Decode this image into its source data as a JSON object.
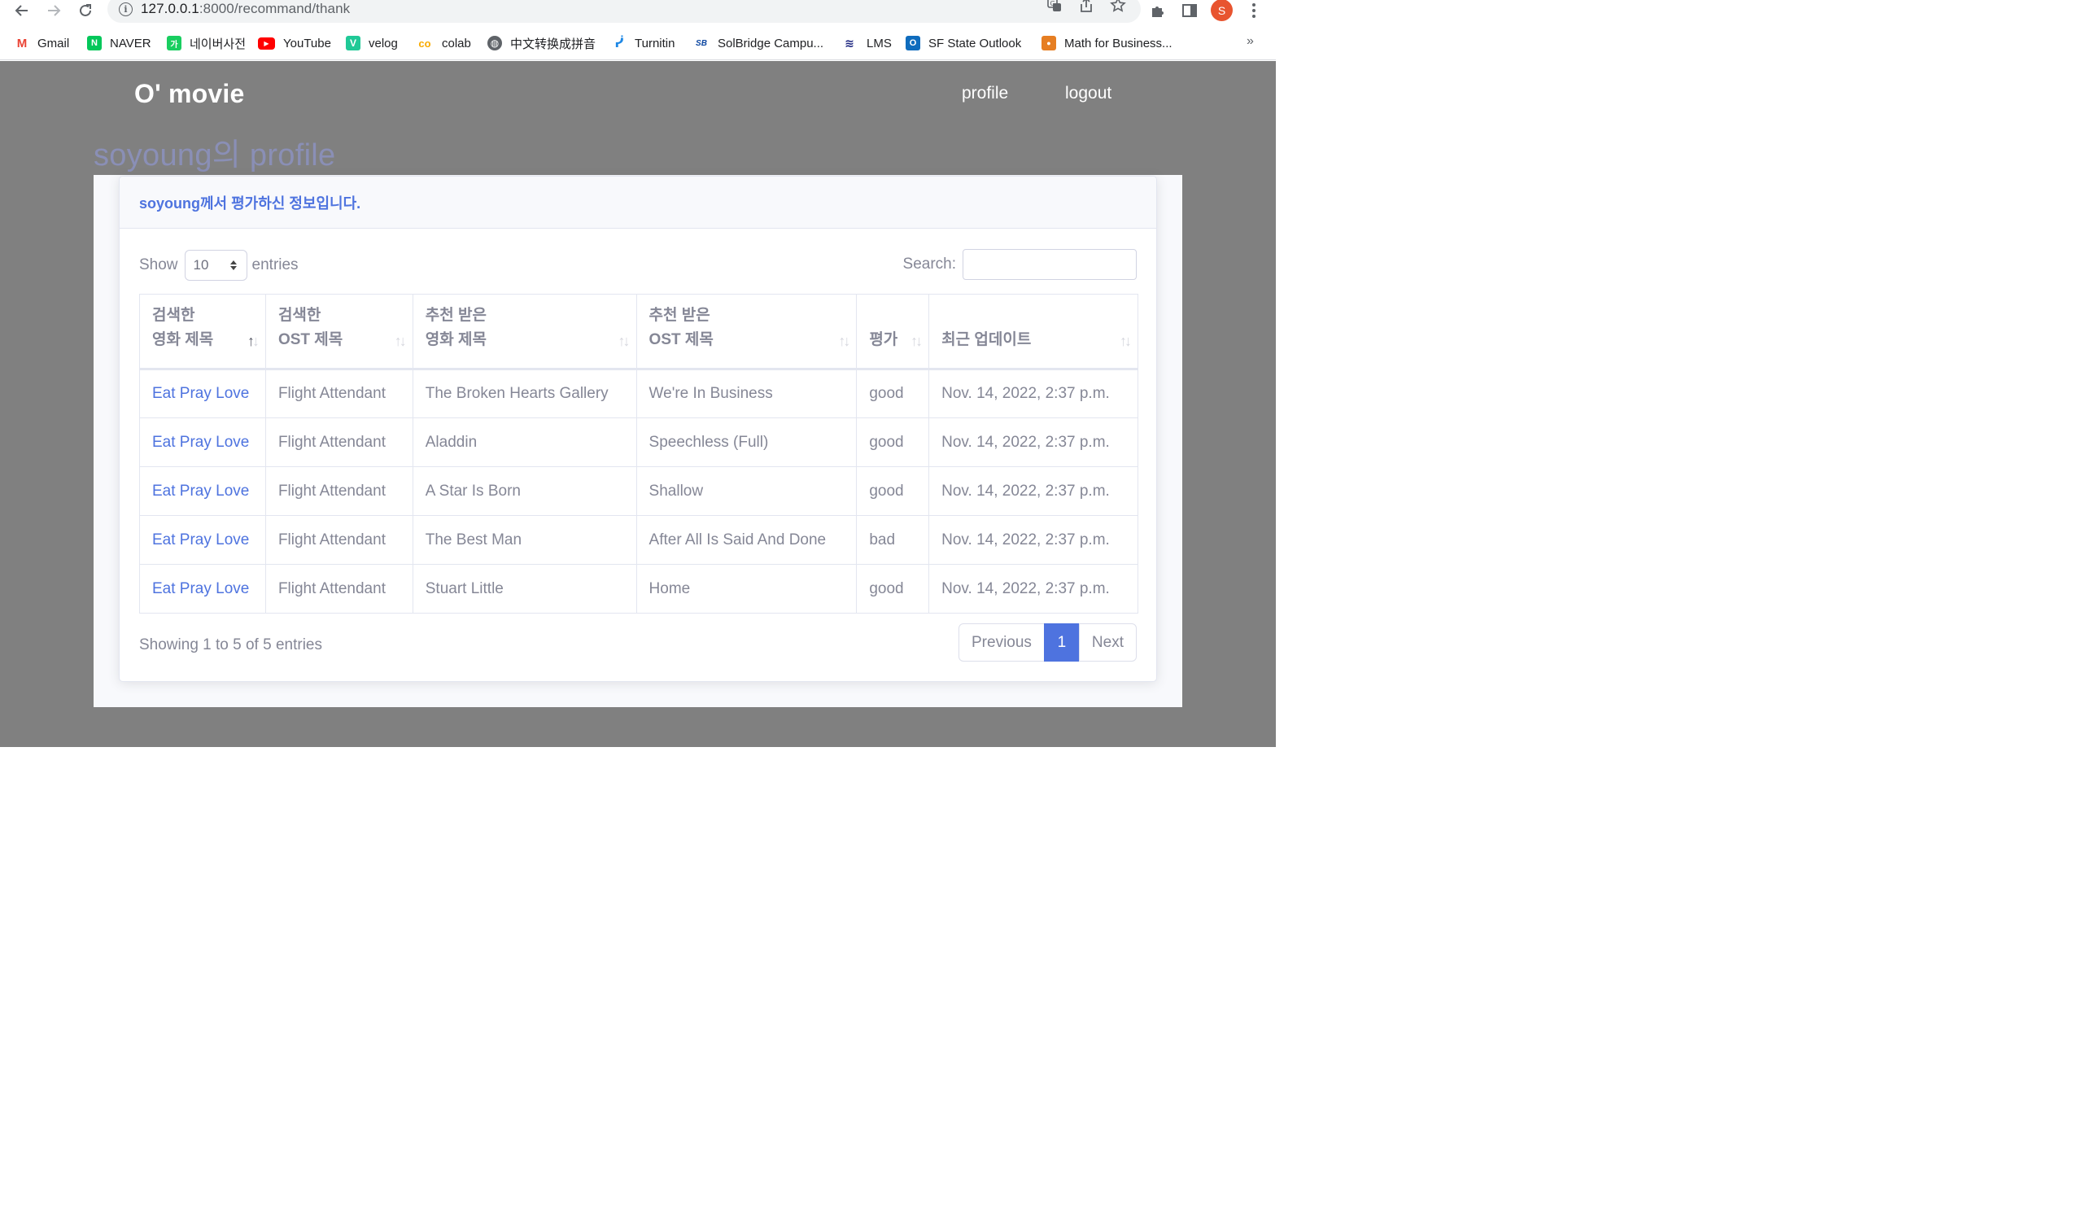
{
  "browser": {
    "url_host": "127.0.0.1",
    "url_rest": ":8000/recommand/thank",
    "profile_initial": "S",
    "bookmarks": [
      {
        "label": "Gmail",
        "icon": "gmail-icon",
        "color": "#ea4335",
        "glyph": "M"
      },
      {
        "label": "NAVER",
        "icon": "naver-icon",
        "color": "#03c75a",
        "glyph": "N"
      },
      {
        "label": "네이버사전",
        "icon": "naver-dictionary-icon",
        "color": "#19ce60",
        "glyph": "가"
      },
      {
        "label": "YouTube",
        "icon": "youtube-icon",
        "color": "#ff0000",
        "glyph": "▶"
      },
      {
        "label": "velog",
        "icon": "velog-icon",
        "color": "#20c997",
        "glyph": "V"
      },
      {
        "label": "colab",
        "icon": "colab-icon",
        "color": "#f9ab00",
        "glyph": "co"
      },
      {
        "label": "中文转换成拼音",
        "icon": "globe-icon",
        "color": "#5f6368",
        "glyph": "◍"
      },
      {
        "label": "Turnitin",
        "icon": "turnitin-icon",
        "color": "#1e88e5",
        "glyph": "ᓰ"
      },
      {
        "label": "SolBridge Campu...",
        "icon": "solbridge-icon",
        "color": "#0d47a1",
        "glyph": "SB"
      },
      {
        "label": "LMS",
        "icon": "lms-icon",
        "color": "#1a237e",
        "glyph": "≋"
      },
      {
        "label": "SF State Outlook",
        "icon": "outlook-icon",
        "color": "#0f6cbd",
        "glyph": "O"
      },
      {
        "label": "Math for Business...",
        "icon": "math-app-icon",
        "color": "#e67e22",
        "glyph": "●"
      }
    ]
  },
  "header": {
    "brand": "O' movie",
    "nav_profile": "profile",
    "nav_logout": "logout"
  },
  "page_heading": "soyoung의 profile",
  "card": {
    "title": "soyoung께서 평가하신 정보입니다."
  },
  "table_controls": {
    "show_label": "Show",
    "entries_value": "10",
    "entries_label": "entries",
    "search_label": "Search:",
    "search_value": ""
  },
  "table": {
    "columns": [
      {
        "line1": "검색한",
        "line2": "영화 제목"
      },
      {
        "line1": "검색한",
        "line2": "OST 제목"
      },
      {
        "line1": "추천 받은",
        "line2": "영화 제목"
      },
      {
        "line1": "추천 받은",
        "line2": "OST 제목"
      },
      {
        "line1": "",
        "line2": "평가"
      },
      {
        "line1": "",
        "line2": "최근 업데이트"
      }
    ],
    "rows": [
      [
        "Eat Pray Love",
        "Flight Attendant",
        "The Broken Hearts Gallery",
        "We're In Business",
        "good",
        "Nov. 14, 2022, 2:37 p.m."
      ],
      [
        "Eat Pray Love",
        "Flight Attendant",
        "Aladdin",
        "Speechless (Full)",
        "good",
        "Nov. 14, 2022, 2:37 p.m."
      ],
      [
        "Eat Pray Love",
        "Flight Attendant",
        "A Star Is Born",
        "Shallow",
        "good",
        "Nov. 14, 2022, 2:37 p.m."
      ],
      [
        "Eat Pray Love",
        "Flight Attendant",
        "The Best Man",
        "After All Is Said And Done",
        "bad",
        "Nov. 14, 2022, 2:37 p.m."
      ],
      [
        "Eat Pray Love",
        "Flight Attendant",
        "Stuart Little",
        "Home",
        "good",
        "Nov. 14, 2022, 2:37 p.m."
      ]
    ]
  },
  "footer": {
    "info": "Showing 1 to 5 of 5 entries",
    "prev": "Previous",
    "page": "1",
    "next": "Next"
  },
  "colors": {
    "page_bg": "#808080",
    "accent": "#4e73df",
    "muted_text": "#858796"
  }
}
